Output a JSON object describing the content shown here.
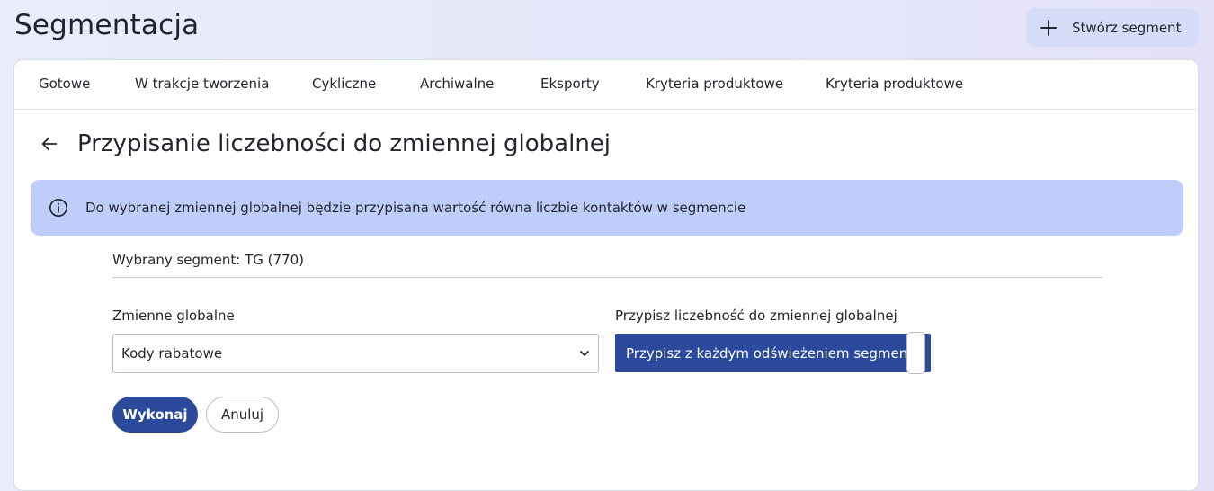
{
  "header": {
    "title": "Segmentacja",
    "create_button_label": "Stwórz segment"
  },
  "tabs": [
    {
      "label": "Gotowe"
    },
    {
      "label": "W trakcje tworzenia"
    },
    {
      "label": "Cykliczne"
    },
    {
      "label": "Archiwalne"
    },
    {
      "label": "Eksporty"
    },
    {
      "label": "Kryteria produktowe"
    },
    {
      "label": "Kryteria produktowe"
    }
  ],
  "section": {
    "title": "Przypisanie liczebności do zmiennej globalnej",
    "info_text": "Do wybranej zmiennej globalnej będzie przypisana wartość równa liczbie kontaktów w segmencie",
    "selected_segment": "Wybrany segment: TG (770)"
  },
  "form": {
    "global_vars_label": "Zmienne globalne",
    "global_vars_value": "Kody rabatowe",
    "assign_label": "Przypisz liczebność do zmiennej globalnej",
    "assign_option": "Przypisz z każdym odświeżeniem segmentu",
    "execute_label": "Wykonaj",
    "cancel_label": "Anuluj"
  },
  "colors": {
    "primary": "#2c4a9c",
    "banner": "#bfcdfb",
    "create_button": "#d4dcf8"
  }
}
